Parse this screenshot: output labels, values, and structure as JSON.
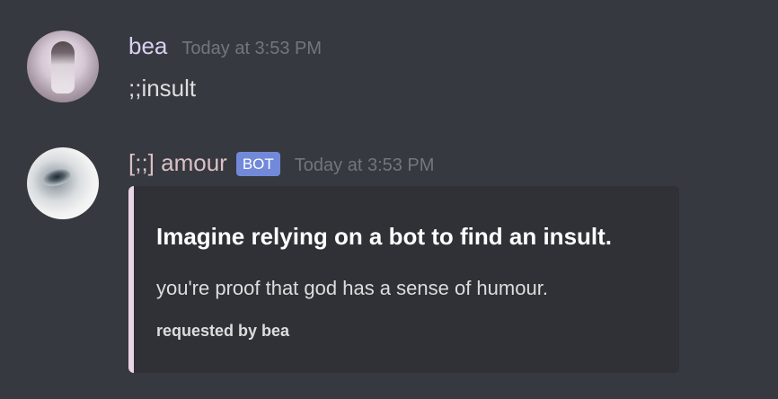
{
  "messages": [
    {
      "avatar": "user-avatar",
      "username": "bea",
      "timestamp": "Today at 3:53 PM",
      "content": ";;insult"
    },
    {
      "avatar": "bot-avatar",
      "username": "[;;] amour",
      "bot_tag": "BOT",
      "timestamp": "Today at 3:53 PM",
      "embed": {
        "accent_color": "#e8d5e6",
        "title": "Imagine relying on a bot to find an insult.",
        "description": "you're proof that god has a sense of humour.",
        "footer": "requested by bea"
      }
    }
  ],
  "colors": {
    "background": "#36393f",
    "embed_background": "#2f3136",
    "bot_tag": "#7289da",
    "timestamp": "#72767d"
  }
}
